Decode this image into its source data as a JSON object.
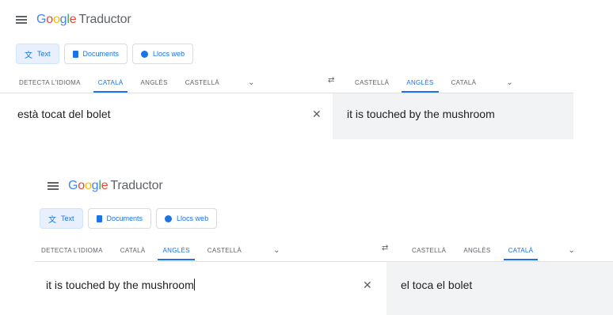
{
  "panels": [
    {
      "app": {
        "logo": "Google",
        "title": "Traductor"
      },
      "modes": [
        "Text",
        "Documents",
        "Llocs web"
      ],
      "source_langs": [
        "DETECTA L'IDIOMA",
        "CATALÀ",
        "ANGLÈS",
        "CASTELLÀ"
      ],
      "target_langs": [
        "CASTELLÀ",
        "ANGLÈS",
        "CATALÀ"
      ],
      "input": "està tocat del bolet",
      "output": "it is touched by the mushroom"
    },
    {
      "app": {
        "logo": "Google",
        "title": "Traductor"
      },
      "modes": [
        "Text",
        "Documents",
        "Llocs web"
      ],
      "source_langs": [
        "DETECTA L'IDIOMA",
        "CATALÀ",
        "ANGLÈS",
        "CASTELLÀ"
      ],
      "target_langs": [
        "CASTELLÀ",
        "ANGLÈS",
        "CATALÀ"
      ],
      "input": "it is touched by the mushroom",
      "output": "el toca el bolet"
    }
  ],
  "icons": {
    "menu": "menu-icon",
    "text_mode": "translate-icon",
    "documents": "document-icon",
    "websites": "globe-icon",
    "swap": "swap-icon",
    "expand": "chevron-down-icon",
    "clear": "close-icon"
  },
  "colors": {
    "accent": "#1a73e8",
    "output_bg": "#f1f3f4"
  }
}
